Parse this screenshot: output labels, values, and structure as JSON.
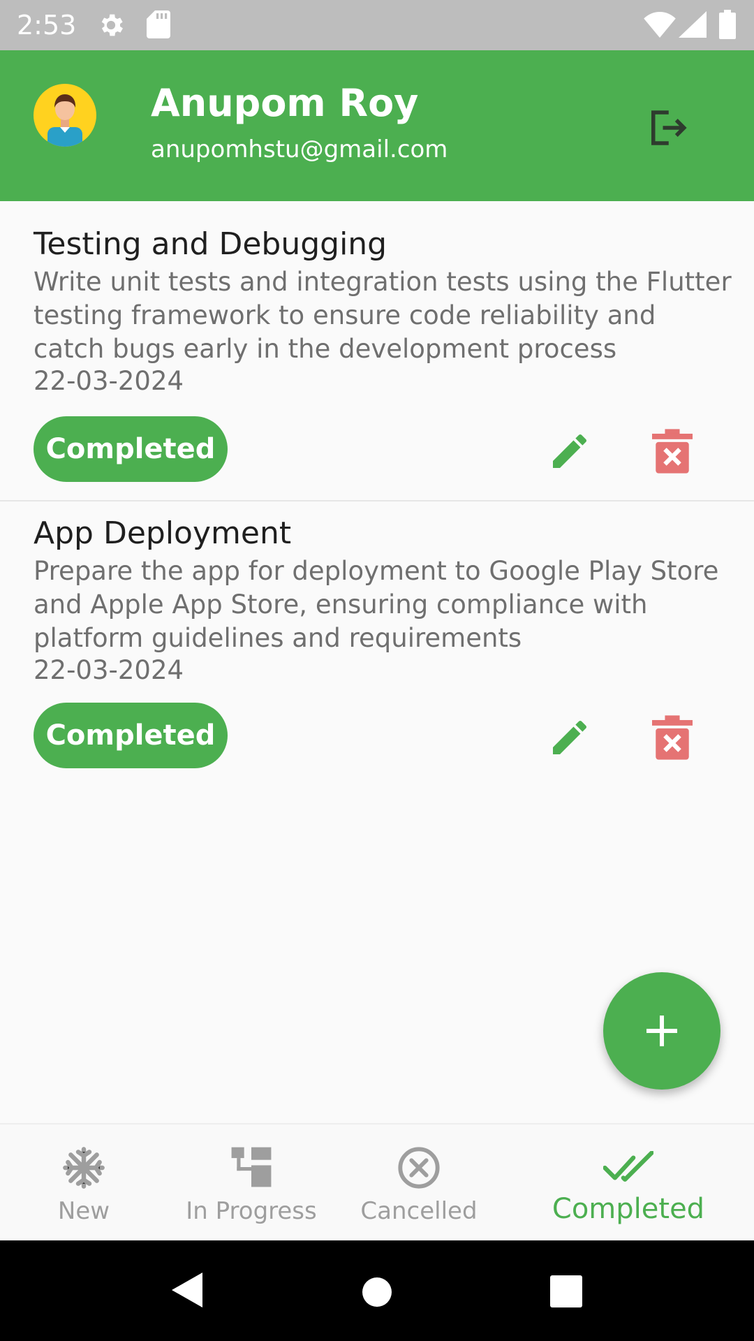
{
  "status_bar": {
    "time": "2:53",
    "icons": [
      "gear-icon",
      "sd-card-icon",
      "wifi-icon",
      "signal-icon",
      "battery-icon"
    ]
  },
  "header": {
    "name": "Anupom Roy",
    "email": "anupomhstu@gmail.com",
    "logout_icon": "logout-icon"
  },
  "tasks": [
    {
      "title": "Testing and Debugging",
      "description": "Write unit tests and integration tests using the Flutter testing framework to ensure code reliability and catch bugs early in the development process",
      "date": "22-03-2024",
      "status": "Completed"
    },
    {
      "title": "App Deployment",
      "description": "Prepare the app for deployment to Google Play Store and Apple App Store, ensuring compliance with platform guidelines and requirements",
      "date": "22-03-2024",
      "status": "Completed"
    }
  ],
  "bottom_nav": {
    "items": [
      {
        "label": "New",
        "icon": "snowflake-icon"
      },
      {
        "label": "In Progress",
        "icon": "hierarchy-icon"
      },
      {
        "label": "Cancelled",
        "icon": "cancel-circle-icon"
      },
      {
        "label": "Completed",
        "icon": "double-check-icon"
      }
    ],
    "active_index": 3
  },
  "colors": {
    "primary": "#4caf50",
    "delete": "#e57373",
    "status_bar": "#bdbdbd",
    "inactive_nav": "#9e9e9e"
  }
}
